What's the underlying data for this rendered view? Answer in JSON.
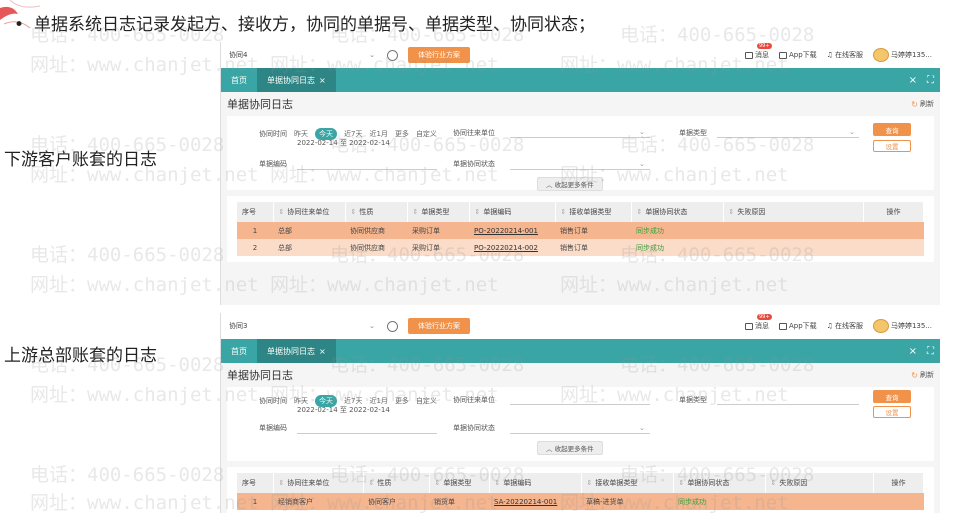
{
  "slide": {
    "bullet_glyph": "•",
    "bullet_text": "单据系统日志记录发起方、接收方，协同的单据号、单据类型、协同状态；",
    "label_downstream": "下游客户账套的日志",
    "label_upstream": "上游总部账套的日志"
  },
  "watermark": {
    "phone": "电话：400-665-0028",
    "site": "网址：www.chanjet.net"
  },
  "colors": {
    "teal": "#3aa5a5",
    "orange": "#f0924a",
    "row_dark": "#f5b58f",
    "row_light": "#fbdcc8",
    "status_green": "#3aa03a"
  },
  "screens": [
    {
      "topbar": {
        "account": "协同4",
        "trial_button": "体验行业方案",
        "message_label": "消息",
        "message_badge": "99+",
        "app_download": "App下载",
        "online_service": "在线客服",
        "user_name": "马婷婷135..."
      },
      "tabs": {
        "home": "首页",
        "active": "单据协同日志"
      },
      "page_title": "单据协同日志",
      "refresh_label": "刷新",
      "filters": {
        "time_label": "协同时间",
        "time_chips": [
          "昨天",
          "今天",
          "近7天",
          "近1月",
          "更多",
          "自定义"
        ],
        "date_range": "2022-02-14 至 2022-02-14",
        "partner_label": "协同往来单位",
        "doc_type_label": "单据类型",
        "doc_no_label": "单据编码",
        "status_label": "单据协同状态",
        "query_button": "查询",
        "settings_button": "设置",
        "collapse_button": "收起更多条件"
      },
      "table": {
        "headers": [
          "序号",
          "协同往来单位",
          "性质",
          "单据类型",
          "单据编码",
          "接收单据类型",
          "单据协同状态",
          "失败原因",
          "操作"
        ],
        "rows": [
          [
            "1",
            "总部",
            "协同供应商",
            "采购订单",
            "PO-20220214-001",
            "销售订单",
            "同步成功",
            "",
            ""
          ],
          [
            "2",
            "总部",
            "协同供应商",
            "采购订单",
            "PO-20220214-002",
            "销售订单",
            "同步成功",
            "",
            ""
          ]
        ]
      }
    },
    {
      "topbar": {
        "account": "协同3",
        "trial_button": "体验行业方案",
        "message_label": "消息",
        "message_badge": "99+",
        "app_download": "App下载",
        "online_service": "在线客服",
        "user_name": "马婷婷135..."
      },
      "tabs": {
        "home": "首页",
        "active": "单据协同日志"
      },
      "page_title": "单据协同日志",
      "refresh_label": "刷新",
      "filters": {
        "time_label": "协同时间",
        "time_chips": [
          "昨天",
          "今天",
          "近7天",
          "近1月",
          "更多",
          "自定义"
        ],
        "date_range": "2022-02-14 至 2022-02-14",
        "partner_label": "协同往来单位",
        "doc_type_label": "单据类型",
        "doc_no_label": "单据编码",
        "status_label": "单据协同状态",
        "query_button": "查询",
        "settings_button": "设置",
        "collapse_button": "收起更多条件"
      },
      "table": {
        "headers": [
          "序号",
          "协同往来单位",
          "性质",
          "单据类型",
          "单据编码",
          "接收单据类型",
          "单据协同状态",
          "失败原因",
          "操作"
        ],
        "rows": [
          [
            "1",
            "经销商客户",
            "协同客户",
            "销货单",
            "SA-20220214-001",
            "草稿-进货单",
            "同步成功",
            "",
            ""
          ]
        ]
      }
    }
  ]
}
